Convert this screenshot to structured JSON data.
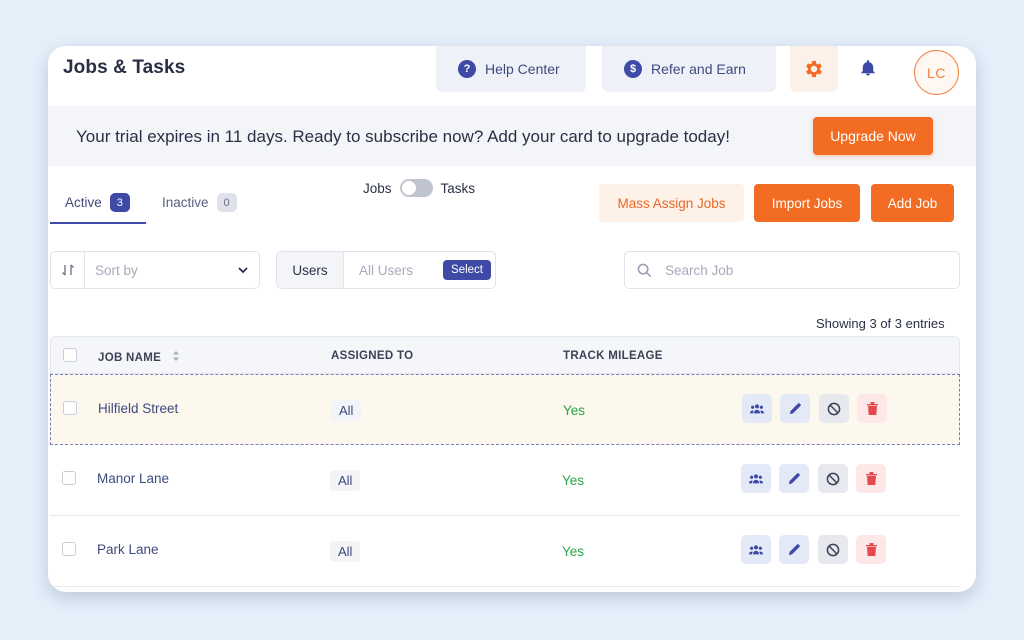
{
  "header": {
    "title": "Jobs & Tasks",
    "help_center": "Help Center",
    "refer_earn": "Refer and Earn",
    "avatar_initials": "LC"
  },
  "banner": {
    "text": "Your trial expires in 11 days. Ready to subscribe now? Add your card to upgrade today!",
    "upgrade_label": "Upgrade Now"
  },
  "tabs": [
    {
      "label": "Active",
      "count": "3"
    },
    {
      "label": "Inactive",
      "count": "0"
    }
  ],
  "toggle": {
    "left_label": "Jobs",
    "right_label": "Tasks"
  },
  "actions": {
    "mass_assign": "Mass Assign Jobs",
    "import": "Import Jobs",
    "add": "Add Job"
  },
  "filters": {
    "sort_placeholder": "Sort by",
    "users_label": "Users",
    "users_value": "All Users",
    "select_label": "Select",
    "search_placeholder": "Search Job"
  },
  "entries_text": "Showing 3 of 3 entries",
  "table": {
    "columns": [
      "JOB NAME",
      "ASSIGNED TO",
      "TRACK MILEAGE"
    ],
    "rows": [
      {
        "job": "Hilfield Street",
        "assigned": "All",
        "mileage": "Yes"
      },
      {
        "job": "Manor Lane",
        "assigned": "All",
        "mileage": "Yes"
      },
      {
        "job": "Park Lane",
        "assigned": "All",
        "mileage": "Yes"
      }
    ]
  },
  "colors": {
    "accent_orange": "#f26c23",
    "primary_indigo": "#3f4aa6",
    "success_green": "#28a745",
    "danger_red": "#e5484d"
  },
  "icons": [
    "help-icon",
    "dollar-icon",
    "gear-icon",
    "bell-icon",
    "sort-icon",
    "chevron-down-icon",
    "search-icon",
    "sort-arrows-icon",
    "team-icon",
    "edit-icon",
    "block-icon",
    "trash-icon"
  ]
}
